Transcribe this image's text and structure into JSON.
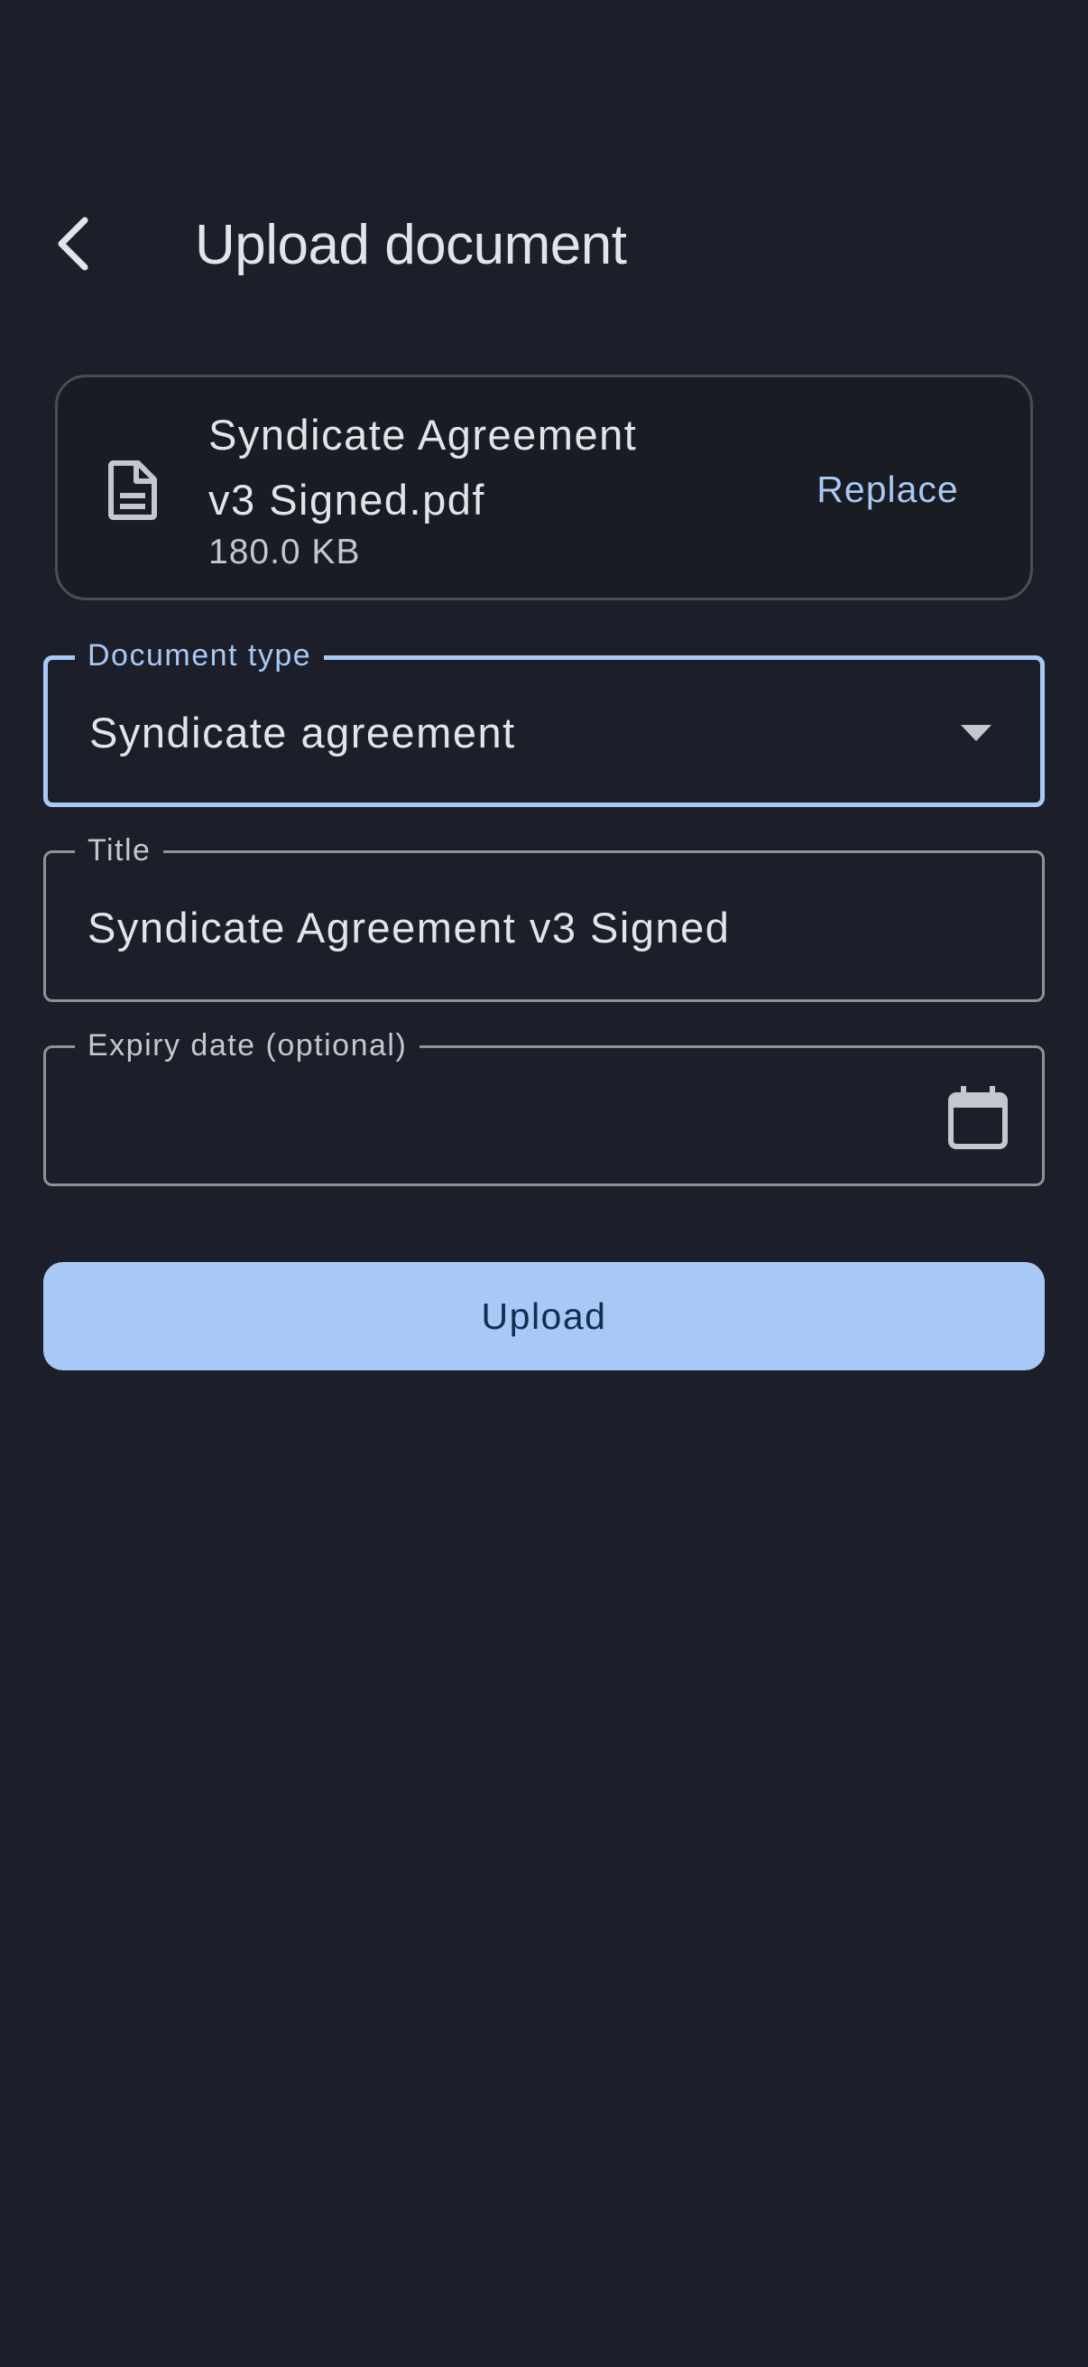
{
  "header": {
    "back_icon": "chevron-left-icon",
    "title": "Upload document"
  },
  "file": {
    "icon": "document-icon",
    "name": "Syndicate Agreement v3 Signed.pdf",
    "size": "180.0 KB",
    "replace_label": "Replace"
  },
  "form": {
    "document_type": {
      "label": "Document type",
      "value": "Syndicate agreement",
      "icon": "dropdown-arrow-icon"
    },
    "title": {
      "label": "Title",
      "value": "Syndicate Agreement v3 Signed"
    },
    "expiry_date": {
      "label": "Expiry date (optional)",
      "value": "",
      "icon": "calendar-icon"
    }
  },
  "actions": {
    "upload_label": "Upload"
  },
  "colors": {
    "background": "#1c1f29",
    "accent": "#a8c8f5",
    "card": "#191c22"
  }
}
